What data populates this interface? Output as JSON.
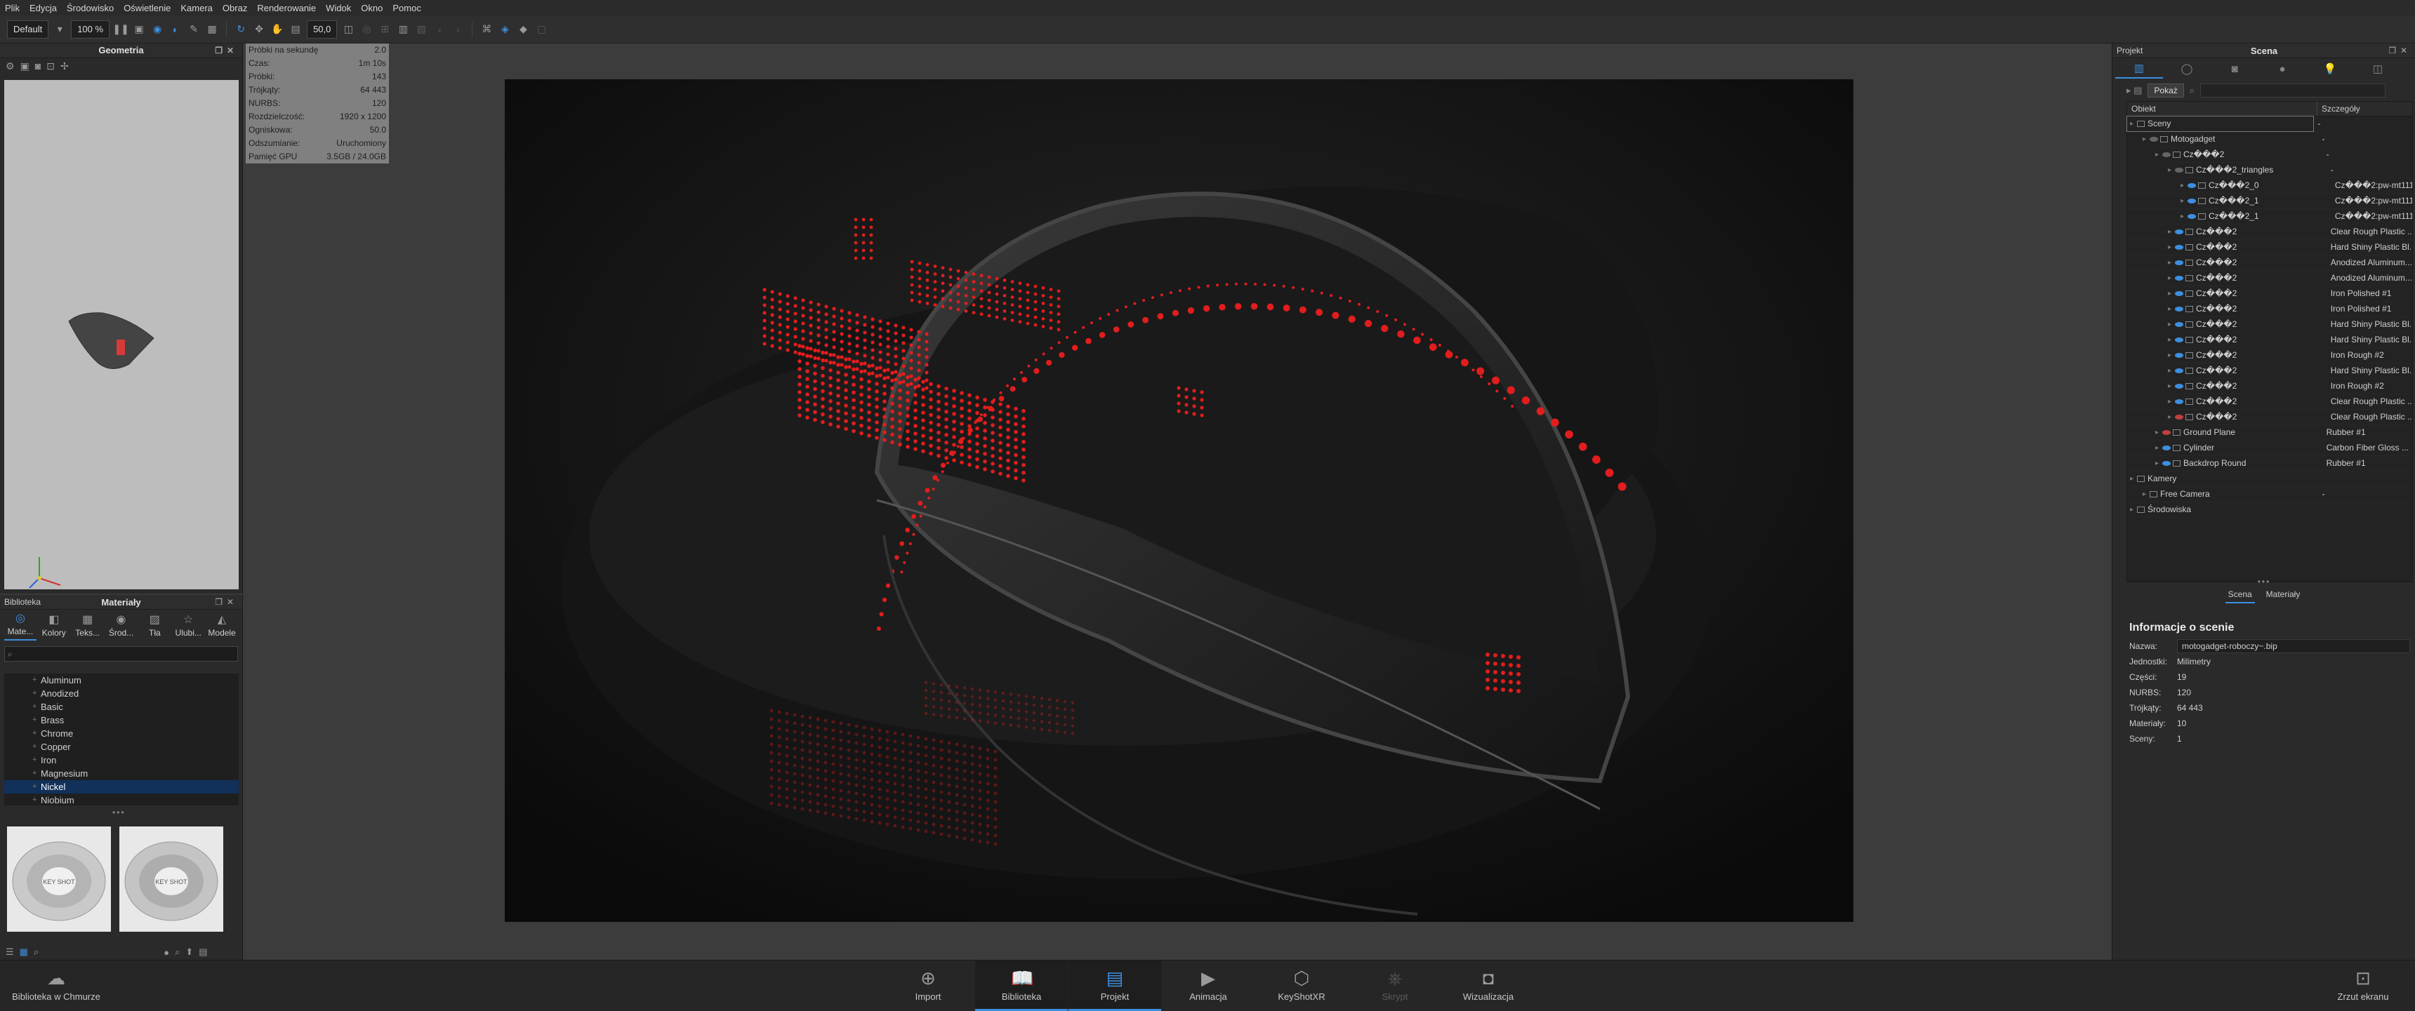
{
  "menu": [
    "Plik",
    "Edycja",
    "Środowisko",
    "Oświetlenie",
    "Kamera",
    "Obraz",
    "Renderowanie",
    "Widok",
    "Okno",
    "Pomoc"
  ],
  "toolbar": {
    "workspace": "Default",
    "zoom": "100 %",
    "fov": "50,0"
  },
  "geometry_panel": {
    "title": "Geometria"
  },
  "stats": [
    {
      "label": "Próbki na sekundę",
      "value": "2.0"
    },
    {
      "label": "Czas:",
      "value": "1m 10s"
    },
    {
      "label": "Próbki:",
      "value": "143"
    },
    {
      "label": "Trójkąty:",
      "value": "64 443"
    },
    {
      "label": "NURBS:",
      "value": "120"
    },
    {
      "label": "Rozdzielczość:",
      "value": "1920 x 1200"
    },
    {
      "label": "Ogniskowa:",
      "value": "50.0"
    },
    {
      "label": "Odszumianie:",
      "value": "Uruchomiony"
    },
    {
      "label": "Pamięć GPU",
      "value": "3.5GB / 24.0GB"
    }
  ],
  "library": {
    "label": "Biblioteka",
    "title": "Materiały",
    "tabs": [
      "Mate...",
      "Kolory",
      "Teks...",
      "Środ...",
      "Tła",
      "Ulubi...",
      "Modele"
    ],
    "tree": [
      "Aluminum",
      "Anodized",
      "Basic",
      "Brass",
      "Chrome",
      "Copper",
      "Iron",
      "Magnesium",
      "Nickel",
      "Niobium"
    ],
    "selected": "Nickel",
    "thumb_text": "KEY SHOT"
  },
  "project": {
    "label": "Projekt",
    "title": "Scena",
    "show_button": "Pokaż",
    "col_object": "Obiekt",
    "col_details": "Szczegóły",
    "rows": [
      {
        "name": "Sceny",
        "detail": "-",
        "indent": 0,
        "sel": true,
        "eye": "none"
      },
      {
        "name": "Motogadget",
        "detail": "-",
        "indent": 1,
        "eye": "grey"
      },
      {
        "name": "Cz���2",
        "detail": "-",
        "indent": 2,
        "eye": "grey"
      },
      {
        "name": "Cz���2_triangles",
        "detail": "-",
        "indent": 3,
        "eye": "grey"
      },
      {
        "name": "Cz���2_0",
        "detail": "Cz���2:pw-mt111...",
        "indent": 4,
        "eye": "on"
      },
      {
        "name": "Cz���2_1",
        "detail": "Cz���2:pw-mt111...",
        "indent": 4,
        "eye": "on"
      },
      {
        "name": "Cz���2_1",
        "detail": "Cz���2:pw-mt111...",
        "indent": 4,
        "eye": "on"
      },
      {
        "name": "Cz���2",
        "detail": "Clear Rough Plastic ...",
        "indent": 3,
        "eye": "on"
      },
      {
        "name": "Cz���2",
        "detail": "Hard Shiny Plastic Bl...",
        "indent": 3,
        "eye": "on"
      },
      {
        "name": "Cz���2",
        "detail": "Anodized Aluminum...",
        "indent": 3,
        "eye": "on"
      },
      {
        "name": "Cz���2",
        "detail": "Anodized Aluminum...",
        "indent": 3,
        "eye": "on"
      },
      {
        "name": "Cz���2",
        "detail": "Iron Polished #1",
        "indent": 3,
        "eye": "on"
      },
      {
        "name": "Cz���2",
        "detail": "Iron Polished #1",
        "indent": 3,
        "eye": "on"
      },
      {
        "name": "Cz���2",
        "detail": "Hard Shiny Plastic Bl...",
        "indent": 3,
        "eye": "on"
      },
      {
        "name": "Cz���2",
        "detail": "Hard Shiny Plastic Bl...",
        "indent": 3,
        "eye": "on"
      },
      {
        "name": "Cz���2",
        "detail": "Iron Rough #2",
        "indent": 3,
        "eye": "on"
      },
      {
        "name": "Cz���2",
        "detail": "Hard Shiny Plastic Bl...",
        "indent": 3,
        "eye": "on"
      },
      {
        "name": "Cz���2",
        "detail": "Iron Rough #2",
        "indent": 3,
        "eye": "on"
      },
      {
        "name": "Cz���2",
        "detail": "Clear Rough Plastic ...",
        "indent": 3,
        "eye": "on"
      },
      {
        "name": "Cz���2",
        "detail": "Clear Rough Plastic ...",
        "indent": 3,
        "eye": "off"
      },
      {
        "name": "Ground Plane",
        "detail": "Rubber #1",
        "indent": 2,
        "eye": "off"
      },
      {
        "name": "Cylinder",
        "detail": "Carbon Fiber Gloss ...",
        "indent": 2,
        "eye": "on"
      },
      {
        "name": "Backdrop Round",
        "detail": "Rubber #1",
        "indent": 2,
        "eye": "on"
      },
      {
        "name": "Kamery",
        "detail": "",
        "indent": 0,
        "eye": "none"
      },
      {
        "name": "Free Camera",
        "detail": "-",
        "indent": 1,
        "eye": "none"
      },
      {
        "name": "Środowiska",
        "detail": "",
        "indent": 0,
        "eye": "none"
      }
    ],
    "bottom_tabs": [
      "Scena",
      "Materiały"
    ],
    "info_title": "Informacje o scenie",
    "info": [
      {
        "k": "Nazwa:",
        "v": "motogadget-roboczy~.bip",
        "box": true
      },
      {
        "k": "Jednostki:",
        "v": "Milimetry"
      },
      {
        "k": "Części:",
        "v": "19"
      },
      {
        "k": "NURBS:",
        "v": "120"
      },
      {
        "k": "Trójkąty:",
        "v": "64 443"
      },
      {
        "k": "Materiały:",
        "v": "10"
      },
      {
        "k": "Sceny:",
        "v": "1"
      }
    ]
  },
  "bottom": {
    "cloud": "Biblioteka w Chmurze",
    "buttons": [
      "Import",
      "Biblioteka",
      "Projekt",
      "Animacja",
      "KeyShotXR",
      "Skrypt",
      "Wizualizacja"
    ],
    "screenshot": "Zrzut ekranu"
  }
}
